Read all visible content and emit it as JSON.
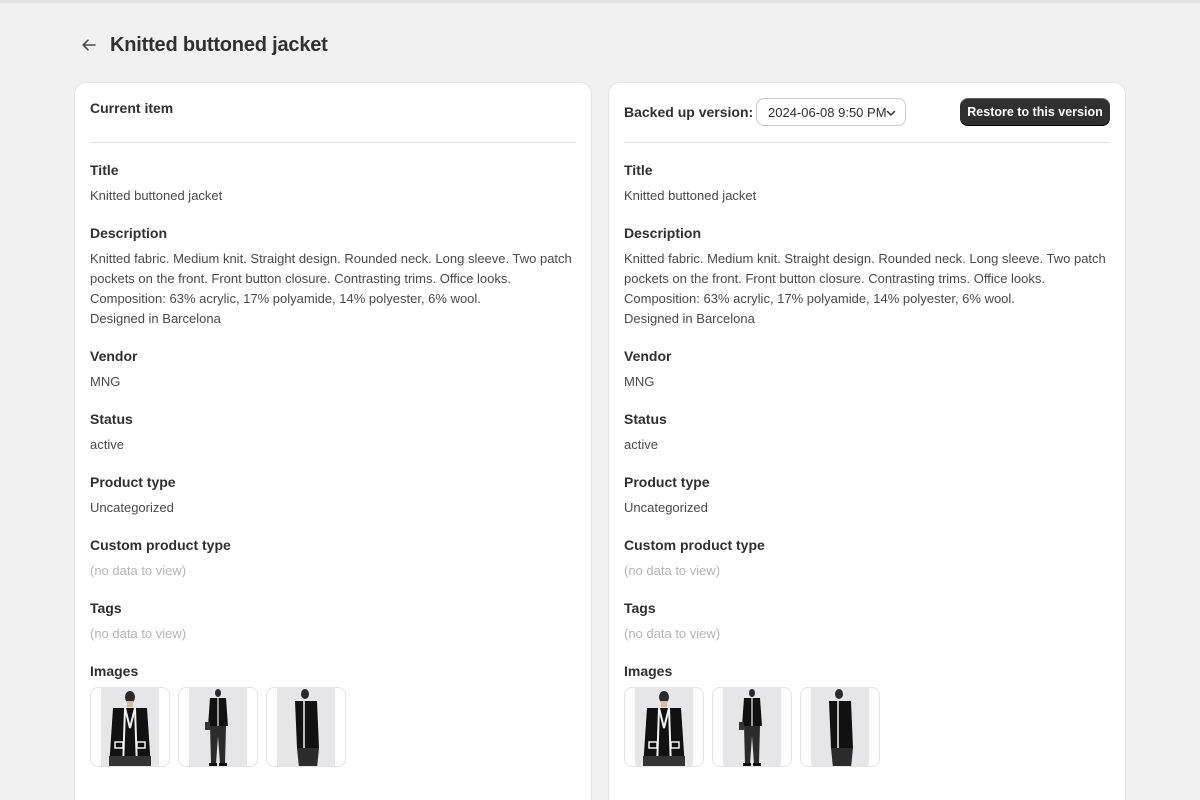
{
  "page": {
    "title": "Knitted buttoned jacket"
  },
  "current": {
    "heading": "Current item",
    "fields": {
      "title": {
        "label": "Title",
        "value": "Knitted buttoned jacket"
      },
      "description": {
        "label": "Description",
        "lines": [
          "Knitted fabric. Medium knit. Straight design. Rounded neck. Long sleeve. Two patch",
          "pockets on the front. Front button closure. Contrasting trims. Office looks.",
          "Composition: 63% acrylic, 17% polyamide, 14% polyester, 6% wool.",
          "Designed in Barcelona"
        ]
      },
      "vendor": {
        "label": "Vendor",
        "value": "MNG"
      },
      "status": {
        "label": "Status",
        "value": "active"
      },
      "product_type": {
        "label": "Product type",
        "value": "Uncategorized"
      },
      "custom_product_type": {
        "label": "Custom product type",
        "value": "(no data to view)"
      },
      "tags": {
        "label": "Tags",
        "value": "(no data to view)"
      },
      "images": {
        "label": "Images"
      }
    }
  },
  "backup": {
    "label": "Backed up version:",
    "selected_version": "2024-06-08 9:50 PM",
    "restore_label": "Restore to this version",
    "fields": {
      "title": {
        "label": "Title",
        "value": "Knitted buttoned jacket"
      },
      "description": {
        "label": "Description",
        "lines": [
          "Knitted fabric. Medium knit. Straight design. Rounded neck. Long sleeve. Two patch",
          "pockets on the front. Front button closure. Contrasting trims. Office looks.",
          "Composition: 63% acrylic, 17% polyamide, 14% polyester, 6% wool.",
          "Designed in Barcelona"
        ]
      },
      "vendor": {
        "label": "Vendor",
        "value": "MNG"
      },
      "status": {
        "label": "Status",
        "value": "active"
      },
      "product_type": {
        "label": "Product type",
        "value": "Uncategorized"
      },
      "custom_product_type": {
        "label": "Custom product type",
        "value": "(no data to view)"
      },
      "tags": {
        "label": "Tags",
        "value": "(no data to view)"
      },
      "images": {
        "label": "Images"
      }
    }
  },
  "icons": {
    "back": "arrow-left-icon",
    "select": "chevron-down-icon"
  },
  "colors": {
    "background": "#f1f1f1",
    "card": "#ffffff",
    "primary_button": "#303030",
    "muted_text": "#b5b5b5"
  }
}
